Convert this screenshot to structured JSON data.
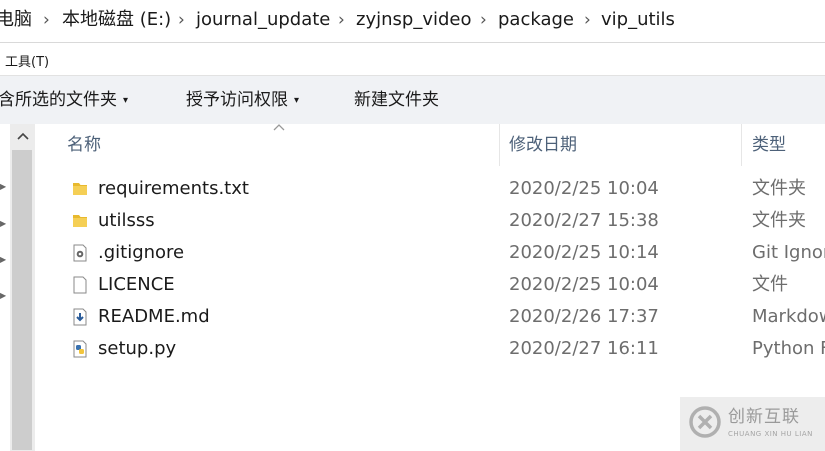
{
  "breadcrumb": {
    "items": [
      "电脑",
      "本地磁盘 (E:)",
      "journal_update",
      "zyjnsp_video",
      "package",
      "vip_utils"
    ],
    "separator": "›"
  },
  "menu": {
    "tools": "工具(T)"
  },
  "toolbar": {
    "include_in_library": "含所选的文件夹",
    "grant_access": "授予访问权限",
    "new_folder": "新建文件夹",
    "caret": "▾"
  },
  "nav": {
    "scroll_up": "^"
  },
  "columns": {
    "name": "名称",
    "date": "修改日期",
    "type": "类型",
    "sort_indicator": "^"
  },
  "files": [
    {
      "name": "requirements.txt",
      "date": "2020/2/25 10:04",
      "type": "文件夹",
      "icon": "folder-icon"
    },
    {
      "name": "utilsss",
      "date": "2020/2/27 15:38",
      "type": "文件夹",
      "icon": "folder-icon"
    },
    {
      "name": ".gitignore",
      "date": "2020/2/25 10:14",
      "type": "Git Ignor",
      "icon": "gear-file-icon"
    },
    {
      "name": "LICENCE",
      "date": "2020/2/25 10:04",
      "type": "文件",
      "icon": "blank-file-icon"
    },
    {
      "name": "README.md",
      "date": "2020/2/26 17:37",
      "type": "Markdow",
      "icon": "download-file-icon"
    },
    {
      "name": "setup.py",
      "date": "2020/2/27 16:11",
      "type": "Python F",
      "icon": "python-file-icon"
    }
  ],
  "watermark": {
    "title": "创新互联",
    "subtitle": "CHUANG XIN HU LIAN"
  },
  "colors": {
    "folder": "#e8b92e",
    "header_text": "#4d6179",
    "secondary_text": "#6d6d6d",
    "toolbar_bg": "#f0f2f5"
  }
}
